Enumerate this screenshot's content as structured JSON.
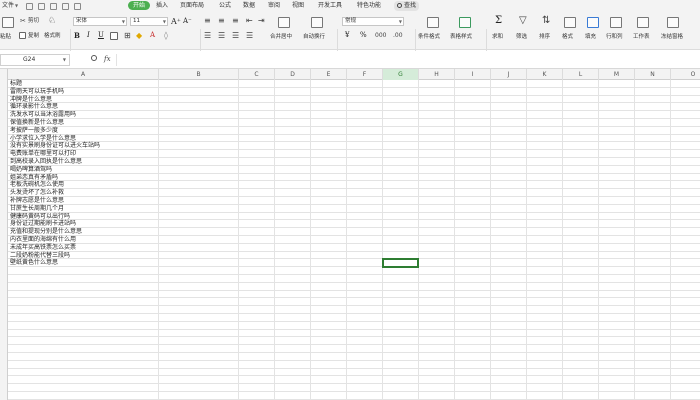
{
  "menubar": {
    "file": "文件",
    "tabs": [
      "开始",
      "插入",
      "页面布局",
      "公式",
      "数据",
      "审阅",
      "视图",
      "开发工具",
      "特色功能"
    ],
    "active_tab": "开始",
    "search": "查找"
  },
  "ribbon": {
    "paste": "粘贴",
    "cut": "剪切",
    "copy": "复制",
    "format_painter": "格式刷",
    "font_name": "宋体",
    "font_size": "11",
    "merge_center": "合并居中",
    "wrap_text": "自动换行",
    "number_format": "常规",
    "conditional_format": "条件格式",
    "table_style": "表格样式",
    "sum": "求和",
    "filter": "筛选",
    "sort": "排序",
    "format": "格式",
    "fill": "填充",
    "row_col": "行和列",
    "worksheet": "工作表",
    "freeze": "冻结窗格",
    "currency_symbol": "¥",
    "percent_symbol": "%"
  },
  "formula_bar": {
    "cell_ref": "G24",
    "fx": "fx",
    "value": ""
  },
  "grid": {
    "columns": [
      "A",
      "B",
      "C",
      "D",
      "E",
      "F",
      "G",
      "H",
      "I",
      "J",
      "K",
      "L",
      "M",
      "N",
      "O"
    ],
    "selected_column": "G",
    "selected_cell": "G24",
    "column_a": [
      "标题",
      "雷雨天可以玩手机吗",
      "冲牌是什么意思",
      "循环录影什么意思",
      "洗发水可以当沐浴露用吗",
      "保值换新是什么意思",
      "考披萨一般多少度",
      "小学求位入学是什么意思",
      "没有实景刷身份证可以进火车站吗",
      "电费账单在哪里可以打印",
      "到高校录入回执是什么意思",
      "喝奶啤算酒驾吗",
      "姐弟恋真有矛盾吗",
      "老板洗碗机怎么使用",
      "头发烫坏了怎么补救",
      "补牌志愿是什么意思",
      "甘蔗生长周期几个月",
      "健康码黄码可以出行吗",
      "身份证过期能刷卡进站吗",
      "充值和提现分别是什么意思",
      "内衣里面的海绵有什么用",
      "未成年买高铁票怎么买票",
      "二段奶粉能代替三段吗",
      "壁纸黄色什么意思"
    ]
  },
  "colors": {
    "accent_green": "#4caf50",
    "selection_green": "#2e7d32"
  }
}
